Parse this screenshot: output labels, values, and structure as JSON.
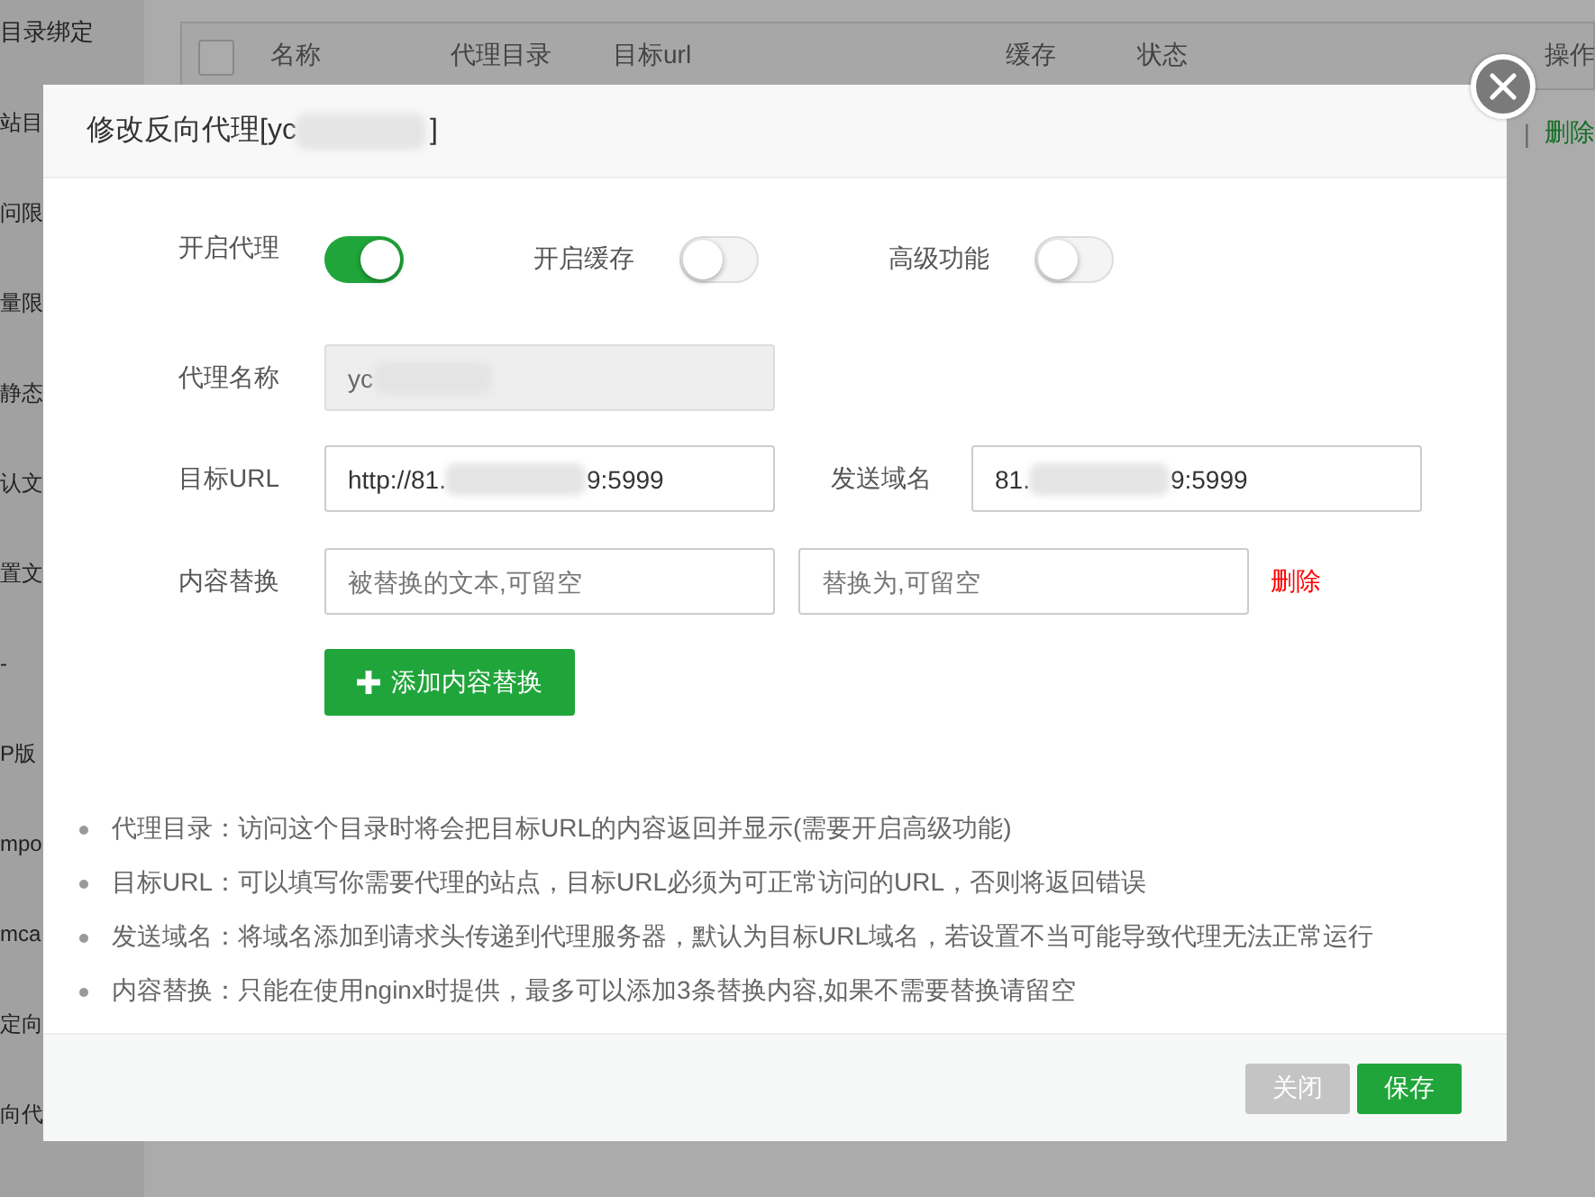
{
  "background": {
    "sidebar_items": [
      "目录绑定",
      "站目",
      "问限",
      "量限",
      "静态",
      "认文",
      "置文",
      "-",
      "P版",
      "mpo",
      "mca",
      "定向",
      "向代"
    ],
    "table": {
      "select_all_checked": false,
      "columns": [
        "名称",
        "代理目录",
        "目标url",
        "缓存",
        "状态",
        "操作"
      ],
      "row_actions": [
        "|",
        "删除"
      ]
    }
  },
  "dialog": {
    "title_prefix": "修改反向代理[yc",
    "title_suffix": "]",
    "switches": [
      {
        "label": "开启代理",
        "on": true
      },
      {
        "label": "开启缓存",
        "on": false
      },
      {
        "label": "高级功能",
        "on": false
      }
    ],
    "name": {
      "label": "代理名称",
      "value_start": "yc",
      "disabled": true
    },
    "target_url": {
      "label": "目标URL",
      "value_start": "http://81.",
      "value_end": "9:5999"
    },
    "send_domain": {
      "label": "发送域名",
      "value_start": "81.",
      "value_end": "9:5999"
    },
    "replace": {
      "label": "内容替换",
      "from_placeholder": "被替换的文本,可留空",
      "to_placeholder": "替换为,可留空",
      "delete": "删除"
    },
    "add_button": "添加内容替换",
    "notes": [
      "代理目录：访问这个目录时将会把目标URL的内容返回并显示(需要开启高级功能)",
      "目标URL：可以填写你需要代理的站点，目标URL必须为可正常访问的URL，否则将返回错误",
      "发送域名：将域名添加到请求头传递到代理服务器，默认为目标URL域名，若设置不当可能导致代理无法正常运行",
      "内容替换：只能在使用nginx时提供，最多可以添加3条替换内容,如果不需要替换请留空"
    ],
    "buttons": [
      {
        "label": "关闭",
        "kind": "secondary"
      },
      {
        "label": "保存",
        "kind": "primary"
      }
    ]
  }
}
